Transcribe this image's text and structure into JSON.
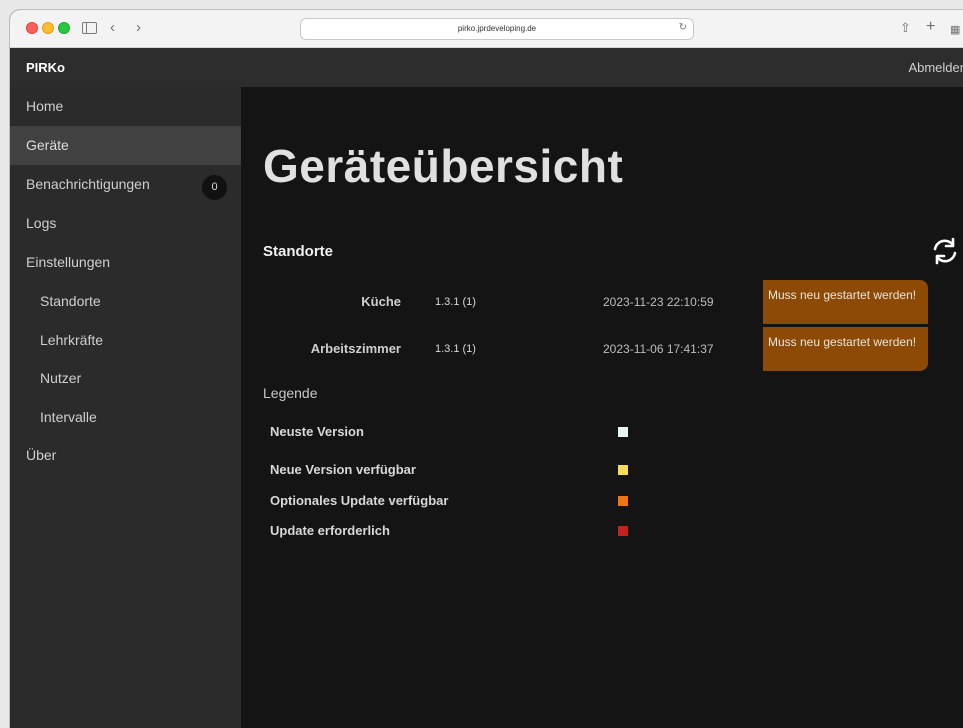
{
  "browser": {
    "url": "pirko.jprdeveloping.de"
  },
  "navbar": {
    "brand": "PIRKo",
    "logout_label": "Abmelden"
  },
  "sidebar": {
    "items": [
      {
        "label": "Home"
      },
      {
        "label": "Geräte",
        "active": true
      },
      {
        "label": "Benachrichtigungen",
        "badge": "0"
      },
      {
        "label": "Logs"
      },
      {
        "label": "Einstellungen"
      },
      {
        "label": "Standorte",
        "sub": true
      },
      {
        "label": "Lehrkräfte",
        "sub": true
      },
      {
        "label": "Nutzer",
        "sub": true
      },
      {
        "label": "Intervalle",
        "sub": true
      },
      {
        "label": "Über"
      }
    ]
  },
  "main": {
    "title": "Geräteübersicht",
    "section_title": "Standorte",
    "refresh_icon": "refresh-icon",
    "locations": [
      {
        "name": "Küche",
        "version": "1.3.1 (1)",
        "date": "2023-11-23 22:10:59",
        "status": "Muss neu gestartet werden!"
      },
      {
        "name": "Arbeitszimmer",
        "version": "1.3.1 (1)",
        "date": "2023-11-06 17:41:37",
        "status": "Muss neu gestartet werden!"
      }
    ],
    "legend": {
      "title": "Legende",
      "items": [
        {
          "label": "Neuste Version",
          "color": "#e6f4ef"
        },
        {
          "label": "Neue Version verfügbar",
          "color": "#f7dc5a"
        },
        {
          "label": "Optionales Update verfügbar",
          "color": "#f07512"
        },
        {
          "label": "Update erforderlich",
          "color": "#c8201e"
        }
      ]
    }
  },
  "colors": {
    "status_alert": "#8c4a05",
    "sidebar_bg": "#2b2b2b",
    "main_bg": "#141414"
  }
}
